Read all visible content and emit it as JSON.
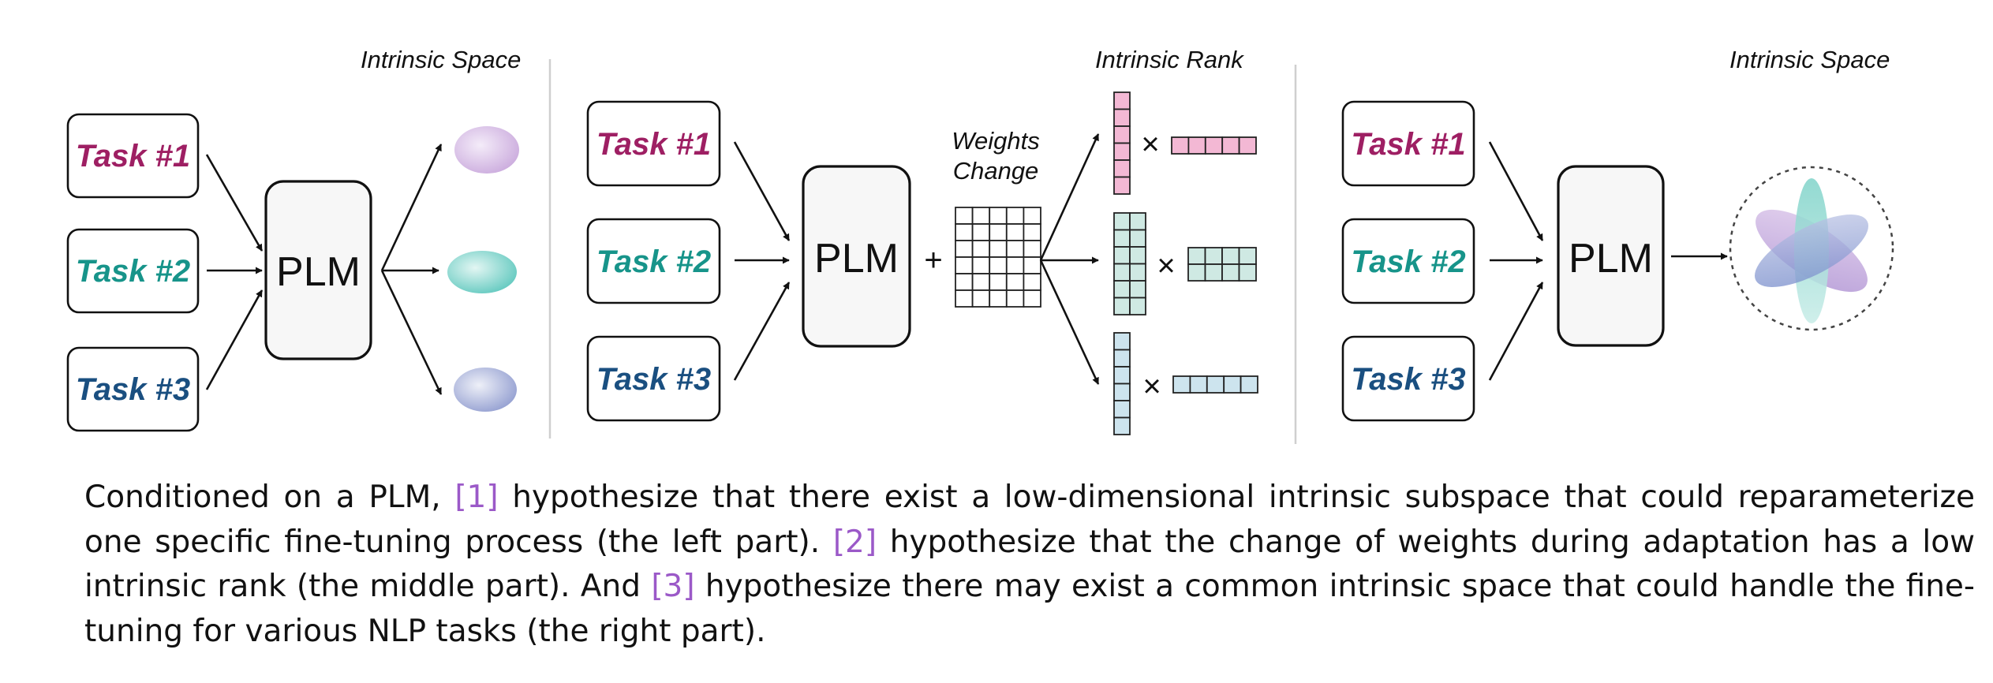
{
  "headers": {
    "left": "Intrinsic Space",
    "middle": "Intrinsic Rank",
    "right": "Intrinsic Space"
  },
  "tasks": [
    "Task #1",
    "Task #2",
    "Task #3"
  ],
  "task_colors": [
    "#9e1f63",
    "#17948a",
    "#1a4f80"
  ],
  "model_label": "PLM",
  "weights_change": [
    "Weights",
    "Change"
  ],
  "operators": {
    "plus": "+",
    "times": "×"
  },
  "caption": {
    "s1": "Conditioned on a PLM, ",
    "ref1": "[1]",
    "s2": " hypothesize that there exist a low-dimensional intrinsic subspace that could reparameterize one specific fine-tuning process (the left part). ",
    "ref2": "[2]",
    "s3": " hypothesize that the change of weights during adaptation has a low intrinsic rank (the middle part). And ",
    "ref3": "[3]",
    "s4": " hypothesize there may exist a common intrinsic space that could handle the fine-tuning for various NLP tasks (the right part)."
  },
  "colors": {
    "citation": "#9b59c8",
    "space_purple": "#c9a8dc",
    "space_teal": "#5cc7bd",
    "space_blue": "#8f9bcf",
    "rank_pink": "#f3b8d4",
    "rank_teal": "#cfe9e3",
    "rank_blue": "#cde4ee"
  }
}
